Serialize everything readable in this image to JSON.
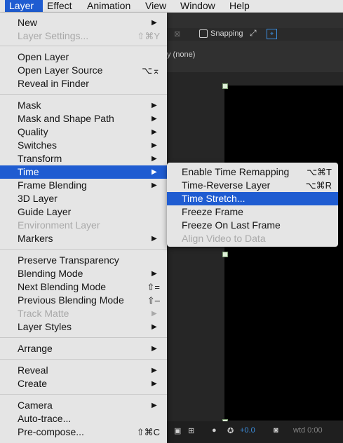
{
  "menubar": [
    "Layer",
    "Effect",
    "Animation",
    "View",
    "Window",
    "Help"
  ],
  "background": {
    "snapping": "Snapping",
    "none": "y (none)",
    "status_value": "+0.0",
    "watermark": "wtd 0:00"
  },
  "menu": {
    "items": [
      {
        "label": "New",
        "shortcut": "",
        "submenu": true,
        "disabled": false
      },
      {
        "label": "Layer Settings...",
        "shortcut": "⇧⌘Y",
        "submenu": false,
        "disabled": true
      },
      {
        "label": "Open Layer",
        "shortcut": "",
        "submenu": false,
        "disabled": false
      },
      {
        "label": "Open Layer Source",
        "shortcut": "⌥⌅",
        "submenu": false,
        "disabled": false
      },
      {
        "label": "Reveal in Finder",
        "shortcut": "",
        "submenu": false,
        "disabled": false
      },
      {
        "label": "Mask",
        "shortcut": "",
        "submenu": true,
        "disabled": false
      },
      {
        "label": "Mask and Shape Path",
        "shortcut": "",
        "submenu": true,
        "disabled": false
      },
      {
        "label": "Quality",
        "shortcut": "",
        "submenu": true,
        "disabled": false
      },
      {
        "label": "Switches",
        "shortcut": "",
        "submenu": true,
        "disabled": false
      },
      {
        "label": "Transform",
        "shortcut": "",
        "submenu": true,
        "disabled": false
      },
      {
        "label": "Time",
        "shortcut": "",
        "submenu": true,
        "disabled": false
      },
      {
        "label": "Frame Blending",
        "shortcut": "",
        "submenu": true,
        "disabled": false
      },
      {
        "label": "3D Layer",
        "shortcut": "",
        "submenu": false,
        "disabled": false
      },
      {
        "label": "Guide Layer",
        "shortcut": "",
        "submenu": false,
        "disabled": false
      },
      {
        "label": "Environment Layer",
        "shortcut": "",
        "submenu": false,
        "disabled": true
      },
      {
        "label": "Markers",
        "shortcut": "",
        "submenu": true,
        "disabled": false
      },
      {
        "label": "Preserve Transparency",
        "shortcut": "",
        "submenu": false,
        "disabled": false
      },
      {
        "label": "Blending Mode",
        "shortcut": "",
        "submenu": true,
        "disabled": false
      },
      {
        "label": "Next Blending Mode",
        "shortcut": "⇧=",
        "submenu": false,
        "disabled": false
      },
      {
        "label": "Previous Blending Mode",
        "shortcut": "⇧–",
        "submenu": false,
        "disabled": false
      },
      {
        "label": "Track Matte",
        "shortcut": "",
        "submenu": true,
        "disabled": true
      },
      {
        "label": "Layer Styles",
        "shortcut": "",
        "submenu": true,
        "disabled": false
      },
      {
        "label": "Arrange",
        "shortcut": "",
        "submenu": true,
        "disabled": false
      },
      {
        "label": "Reveal",
        "shortcut": "",
        "submenu": true,
        "disabled": false
      },
      {
        "label": "Create",
        "shortcut": "",
        "submenu": true,
        "disabled": false
      },
      {
        "label": "Camera",
        "shortcut": "",
        "submenu": true,
        "disabled": false
      },
      {
        "label": "Auto-trace...",
        "shortcut": "",
        "submenu": false,
        "disabled": false
      },
      {
        "label": "Pre-compose...",
        "shortcut": "⇧⌘C",
        "submenu": false,
        "disabled": false
      }
    ]
  },
  "submenu": {
    "items": [
      {
        "label": "Enable Time Remapping",
        "shortcut": "⌥⌘T",
        "disabled": false
      },
      {
        "label": "Time-Reverse Layer",
        "shortcut": "⌥⌘R",
        "disabled": false
      },
      {
        "label": "Time Stretch...",
        "shortcut": "",
        "disabled": false
      },
      {
        "label": "Freeze Frame",
        "shortcut": "",
        "disabled": false
      },
      {
        "label": "Freeze On Last Frame",
        "shortcut": "",
        "disabled": false
      },
      {
        "label": "Align Video to Data",
        "shortcut": "",
        "disabled": true
      }
    ]
  },
  "colors": {
    "accent": "#1f5cd1",
    "menu_bg": "#e5e5e5",
    "disabled": "#a9a9a9"
  }
}
